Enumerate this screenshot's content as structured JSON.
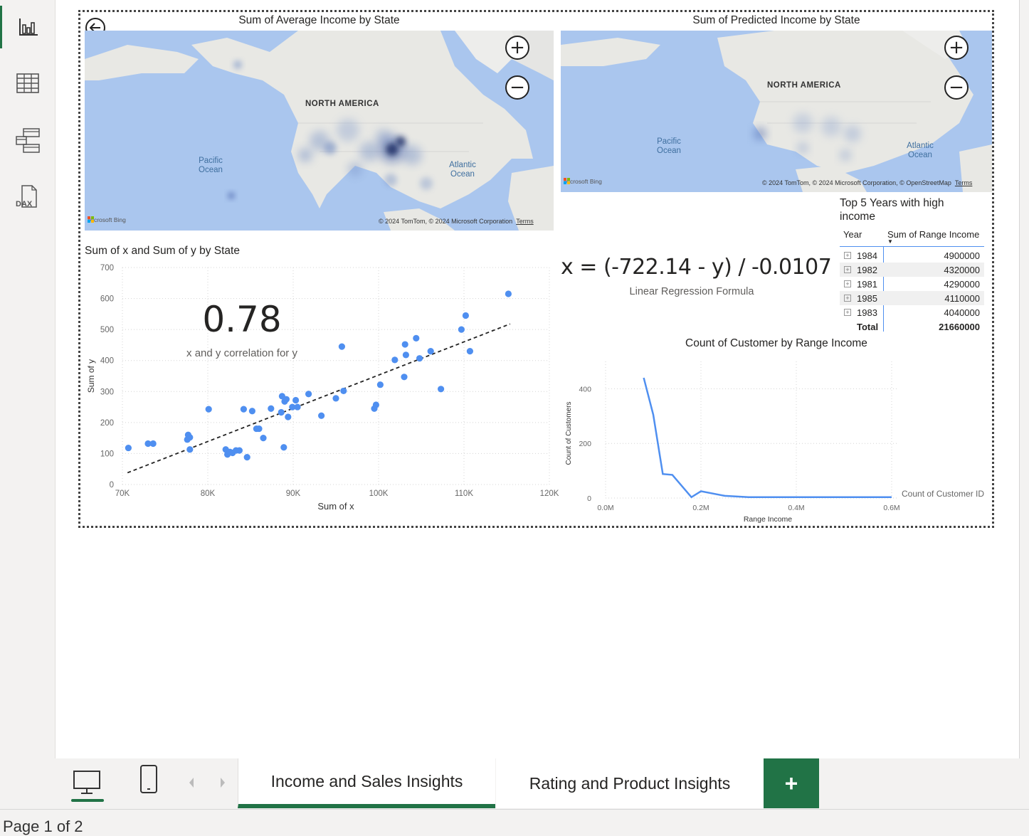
{
  "sidebar": {
    "items": [
      {
        "name": "report-view",
        "icon": "bar-chart-icon"
      },
      {
        "name": "table-view",
        "icon": "table-grid-icon"
      },
      {
        "name": "model-view",
        "icon": "model-diagram-icon"
      },
      {
        "name": "dax-query-view",
        "icon": "dax-icon",
        "label": "DAX"
      }
    ]
  },
  "map1": {
    "title": "Sum of Average Income by State",
    "label_land": "NORTH AMERICA",
    "label_pacific": "Pacific Ocean",
    "label_atlantic": "Atlantic Ocean",
    "bing": "Microsoft Bing",
    "copyright": "© 2024 TomTom, © 2024 Microsoft Corporation",
    "terms": "Terms",
    "zoom_in": "+",
    "zoom_out": "−"
  },
  "map2": {
    "title": "Sum of Predicted Income by State",
    "label_land": "NORTH AMERICA",
    "label_pacific": "Pacific Ocean",
    "label_atlantic": "Atlantic Ocean",
    "bing": "Microsoft Bing",
    "copyright": "© 2024 TomTom, © 2024 Microsoft Corporation, © OpenStreetMap",
    "terms": "Terms",
    "zoom_in": "+",
    "zoom_out": "−"
  },
  "card": {
    "value": "0.78",
    "label": "x and y correlation for y"
  },
  "formula": {
    "text": "x = (-722.14 - y) / -0.0107",
    "label": "Linear Regression Formula"
  },
  "table": {
    "title": "Top 5 Years with high income",
    "col_year": "Year",
    "col_value": "Sum of Range Income",
    "rows": [
      {
        "year": "1984",
        "value": "4900000"
      },
      {
        "year": "1982",
        "value": "4320000"
      },
      {
        "year": "1981",
        "value": "4290000"
      },
      {
        "year": "1985",
        "value": "4110000"
      },
      {
        "year": "1983",
        "value": "4040000"
      }
    ],
    "total_label": "Total",
    "total_value": "21660000"
  },
  "chart_data": [
    {
      "type": "scatter",
      "title": "Sum of x and Sum of y by State",
      "xlabel": "Sum of x",
      "ylabel": "Sum of y",
      "xlim": [
        70000,
        120000
      ],
      "ylim": [
        0,
        700
      ],
      "xticks": [
        70000,
        80000,
        90000,
        100000,
        110000,
        120000
      ],
      "xtick_labels": [
        "70K",
        "80K",
        "90K",
        "100K",
        "110K",
        "120K"
      ],
      "yticks": [
        0,
        100,
        200,
        300,
        400,
        500,
        600,
        700
      ],
      "trendline": {
        "x": [
          70600,
          115400
        ],
        "y": [
          38,
          518
        ],
        "style": "dashed"
      },
      "color": "#4f8ff0",
      "points": [
        [
          70700,
          118
        ],
        [
          73000,
          132
        ],
        [
          73600,
          132
        ],
        [
          77600,
          145
        ],
        [
          77700,
          160
        ],
        [
          77900,
          152
        ],
        [
          77900,
          113
        ],
        [
          80100,
          243
        ],
        [
          82100,
          113
        ],
        [
          82300,
          97
        ],
        [
          82600,
          105
        ],
        [
          82900,
          102
        ],
        [
          83300,
          110
        ],
        [
          83700,
          110
        ],
        [
          84200,
          243
        ],
        [
          84600,
          88
        ],
        [
          85200,
          237
        ],
        [
          85700,
          180
        ],
        [
          86000,
          180
        ],
        [
          86500,
          150
        ],
        [
          87400,
          245
        ],
        [
          88600,
          233
        ],
        [
          88700,
          285
        ],
        [
          88900,
          120
        ],
        [
          89000,
          268
        ],
        [
          89200,
          275
        ],
        [
          89400,
          218
        ],
        [
          89900,
          250
        ],
        [
          90300,
          272
        ],
        [
          90500,
          250
        ],
        [
          91800,
          292
        ],
        [
          93300,
          222
        ],
        [
          95000,
          278
        ],
        [
          95700,
          445
        ],
        [
          95900,
          302
        ],
        [
          99500,
          245
        ],
        [
          99700,
          257
        ],
        [
          100200,
          322
        ],
        [
          101900,
          402
        ],
        [
          103000,
          347
        ],
        [
          103100,
          452
        ],
        [
          103200,
          418
        ],
        [
          104400,
          472
        ],
        [
          104800,
          407
        ],
        [
          106100,
          430
        ],
        [
          107300,
          308
        ],
        [
          109700,
          500
        ],
        [
          110200,
          545
        ],
        [
          110700,
          430
        ],
        [
          115200,
          615
        ]
      ]
    },
    {
      "type": "line",
      "title": "Count of Customer by Range Income",
      "xlabel": "Range Income",
      "ylabel": "Count of Customers",
      "xlim": [
        0,
        0.6
      ],
      "ylim": [
        0,
        500
      ],
      "xticks": [
        0,
        0.2,
        0.4,
        0.6
      ],
      "xtick_labels": [
        "0.0M",
        "0.2M",
        "0.4M",
        "0.6M"
      ],
      "yticks": [
        0,
        200,
        400
      ],
      "legend": "Count of Customer ID",
      "legend_position": "right",
      "color": "#4f8ff0",
      "x": [
        0.08,
        0.1,
        0.12,
        0.14,
        0.18,
        0.2,
        0.25,
        0.3,
        0.4,
        0.5,
        0.6
      ],
      "y": [
        440,
        305,
        88,
        85,
        3,
        25,
        8,
        3,
        3,
        3,
        3
      ]
    }
  ],
  "bottom_bar": {
    "tabs": [
      "Income and Sales Insights",
      "Rating and Product Insights"
    ],
    "add_label": "+",
    "page_status": "Page 1 of 2"
  },
  "colors": {
    "accent": "#217346",
    "data_blue": "#4f8ff0",
    "map_water": "#aac6ee"
  }
}
